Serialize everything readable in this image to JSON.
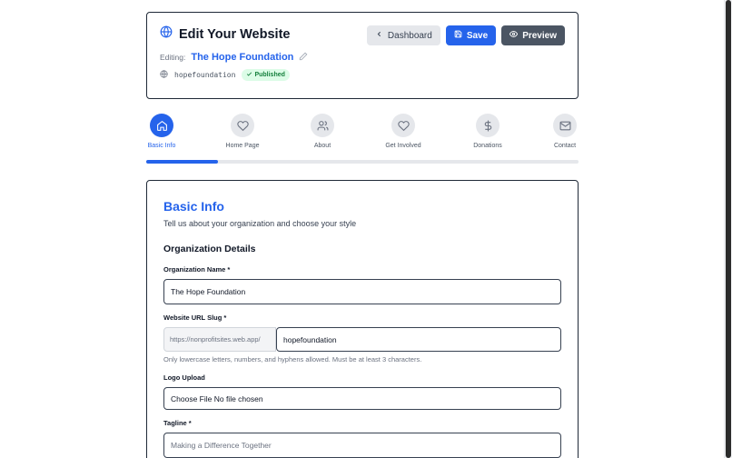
{
  "header": {
    "title": "Edit Your Website",
    "editing_label": "Editing:",
    "org_name": "The Hope Foundation",
    "slug": "hopefoundation",
    "status_badge": "Published",
    "buttons": {
      "dashboard": "Dashboard",
      "save": "Save",
      "preview": "Preview"
    }
  },
  "steps": [
    {
      "label": "Basic Info",
      "icon": "home-icon",
      "active": true
    },
    {
      "label": "Home Page",
      "icon": "heart-icon",
      "active": false
    },
    {
      "label": "About",
      "icon": "users-icon",
      "active": false
    },
    {
      "label": "Get Involved",
      "icon": "heart-icon",
      "active": false
    },
    {
      "label": "Donations",
      "icon": "dollar-icon",
      "active": false
    },
    {
      "label": "Contact",
      "icon": "mail-icon",
      "active": false
    }
  ],
  "progress": {
    "fraction": 0.167
  },
  "form": {
    "title": "Basic Info",
    "description": "Tell us about your organization and choose your style",
    "section_title": "Organization Details",
    "org_name_label": "Organization Name *",
    "org_name_value": "The Hope Foundation",
    "url_slug_label": "Website URL Slug *",
    "url_prefix": "https://nonprofitsites.web.app/",
    "url_slug_value": "hopefoundation",
    "url_hint": "Only lowercase letters, numbers, and hyphens allowed. Must be at least 3 characters.",
    "logo_label": "Logo Upload",
    "logo_value": "Choose File No file chosen",
    "tagline_label": "Tagline *",
    "tagline_placeholder": "Making a Difference Together"
  },
  "colors": {
    "accent": "#2563eb",
    "badge_bg": "#dcfce7",
    "badge_text": "#15803d"
  }
}
